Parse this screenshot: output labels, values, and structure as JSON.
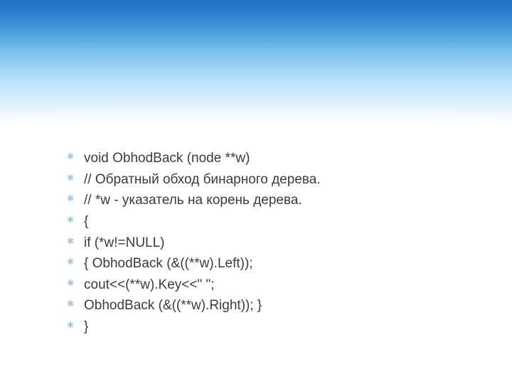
{
  "slide": {
    "lines": [
      "void ObhodBack (node **w)",
      "// Обратный обход бинарного дерева.",
      "// *w - указатель на корень дерева.",
      "{",
      "  if (*w!=NULL)",
      "  { ObhodBack (&((**w).Left));",
      "    cout<<(**w).Key<<\" \";",
      "    ObhodBack (&((**w).Right)); }",
      "}"
    ]
  }
}
